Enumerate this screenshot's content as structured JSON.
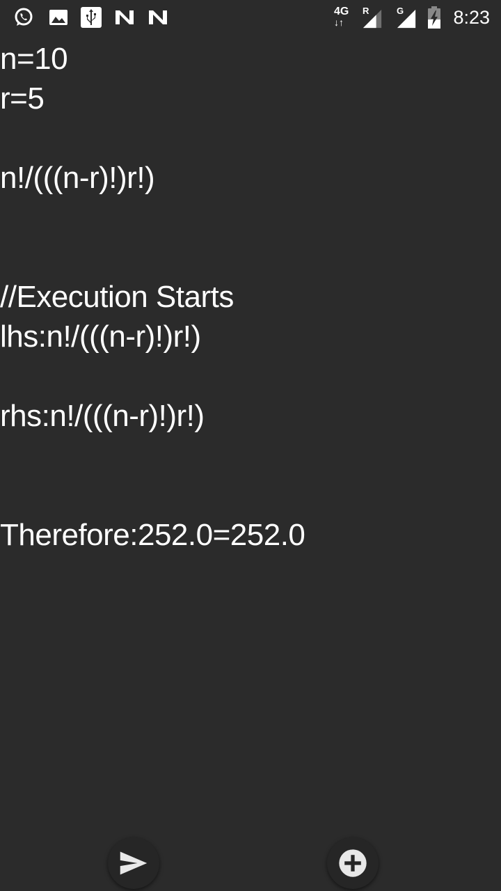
{
  "status_bar": {
    "network_label": "4G",
    "roaming_label": "R",
    "signal2_label": "G",
    "time": "8:23",
    "icons": [
      "whatsapp-icon",
      "gallery-icon",
      "usb-icon",
      "n-notification-icon",
      "n-notification-icon",
      "signal-icon",
      "signal-icon",
      "battery-icon"
    ]
  },
  "output": {
    "line1": "n=10",
    "line2": "r=5",
    "line3": "n!/(((n-r)!)r!)",
    "line4": "//Execution Starts",
    "line5": "lhs:n!/(((n-r)!)r!)",
    "line6": "rhs:n!/(((n-r)!)r!)",
    "line7": "Therefore:252.0=252.0"
  },
  "actions": {
    "send_icon": "send-icon",
    "add_icon": "add-icon"
  }
}
